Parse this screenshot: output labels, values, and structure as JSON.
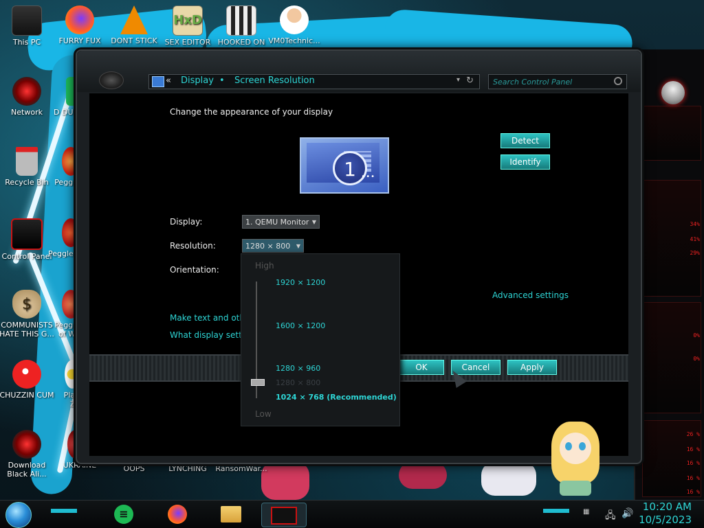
{
  "desktop": {
    "icons": [
      {
        "label": "This PC",
        "icon": "computer-icon"
      },
      {
        "label": "FURRY FUX",
        "icon": "firefox-icon"
      },
      {
        "label": "DONT STICK",
        "icon": "vlc-icon"
      },
      {
        "label": "SEX EDITOR",
        "icon": "hxd-editor-icon"
      },
      {
        "label": "HOOKED ON",
        "icon": "maze-icon"
      },
      {
        "label": "VM0Technic...",
        "icon": "doctor-icon"
      },
      {
        "label": "Network",
        "icon": "network-icon"
      },
      {
        "label": "D DUM",
        "icon": "green-app-icon"
      },
      {
        "label": "Recycle Bin",
        "icon": "recycle-bin-icon"
      },
      {
        "label": "Peggle",
        "icon": "peggle-icon"
      },
      {
        "label": "Control Panel",
        "icon": "control-panel-icon"
      },
      {
        "label": "Peggle De",
        "icon": "peggle-deluxe-icon"
      },
      {
        "label": "COMMUNISTS HATE THIS G...",
        "icon": "money-bag-icon"
      },
      {
        "label": "Peggle of Wa",
        "icon": "peggle-nights-icon"
      },
      {
        "label": "CHUZZIN CUM",
        "icon": "chuzzle-icon"
      },
      {
        "label": "Plan Zo",
        "icon": "flower-icon"
      },
      {
        "label": "Download Black Ali...",
        "icon": "alien-download-icon"
      },
      {
        "label": "UKRAINE",
        "icon": "ukraine-icon"
      },
      {
        "label": "OOPS",
        "icon": "oops-icon"
      },
      {
        "label": "LYNCHING",
        "icon": "lynching-icon"
      },
      {
        "label": "RansomWar...",
        "icon": "ransomware-icon"
      }
    ]
  },
  "hud": {
    "values": [
      "34%",
      "41%",
      "29%",
      "0%",
      "0%",
      "26 %",
      "16 %",
      "16 %",
      "16 %",
      "16 %"
    ],
    "accent": "#e22222"
  },
  "window": {
    "breadcrumb_back": "«",
    "breadcrumb_display": "Display",
    "breadcrumb_sep": "•",
    "breadcrumb_current": "Screen Resolution",
    "search_placeholder": "Search Control Panel",
    "heading": "Change the appearance of your display",
    "monitor_number": "1",
    "detect_label": "Detect",
    "identify_label": "Identify",
    "display_label": "Display:",
    "display_value": "1. QEMU Monitor",
    "resolution_label": "Resolution:",
    "resolution_value": "1280 × 800",
    "orientation_label": "Orientation:",
    "advanced_link": "Advanced settings",
    "text_link": "Make text and other",
    "display_settings_link": "What display setting",
    "ok_label": "OK",
    "cancel_label": "Cancel",
    "apply_label": "Apply",
    "accent": "#2ed6d6"
  },
  "resolution_dropdown": {
    "high_label": "High",
    "low_label": "Low",
    "options": [
      "1920 × 1200",
      "1600 × 1200",
      "1280 × 960",
      "1280 × 800",
      "1024 × 768 (Recommended)"
    ]
  },
  "taskbar": {
    "time": "10:20 AM",
    "date": "10/5/2023",
    "apps": [
      "spotify-icon",
      "firefox-icon",
      "file-explorer-icon",
      "control-panel-icon"
    ]
  }
}
